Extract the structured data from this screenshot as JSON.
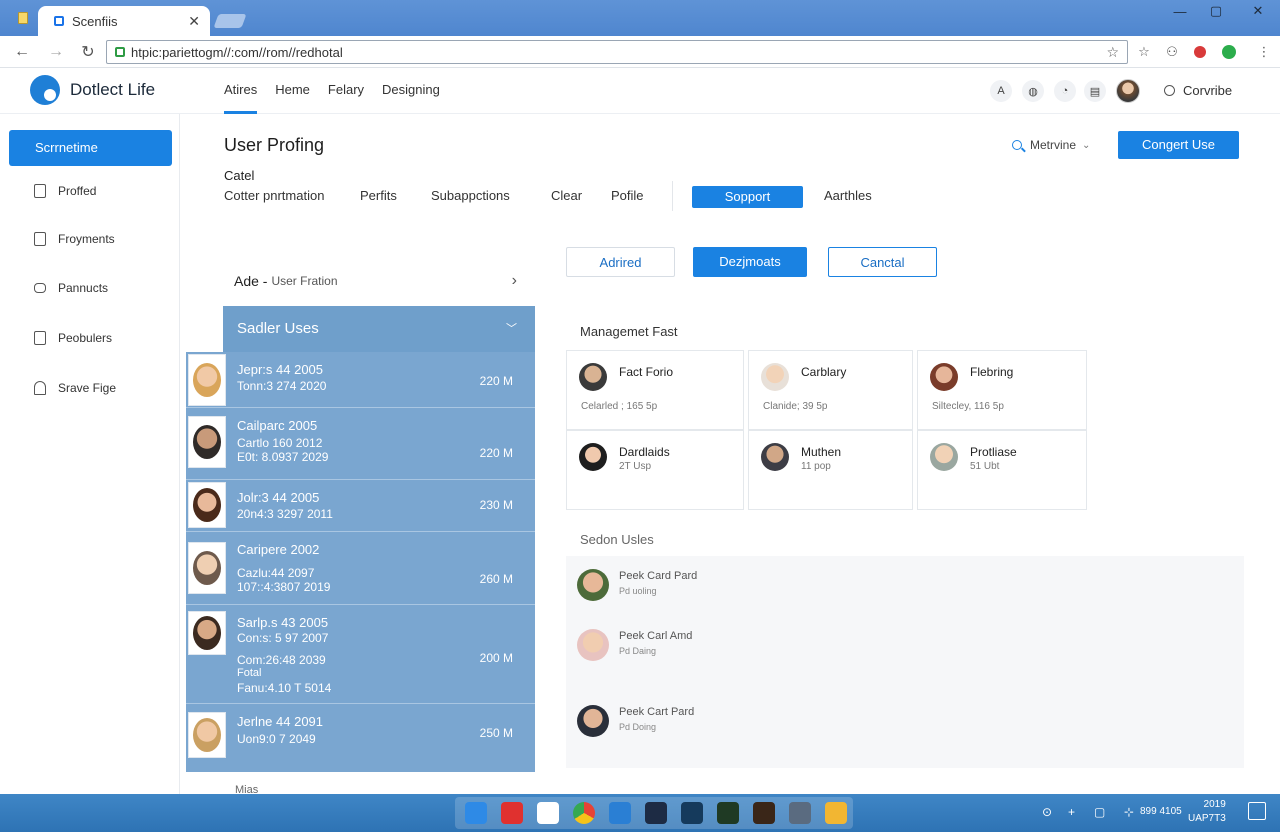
{
  "browser": {
    "tab_title": "Scenfiis",
    "tab_close": "✕",
    "url": "htpic:pariettogm//:com//rom//redhotal",
    "star_icon": "☆"
  },
  "app": {
    "brand": "Dotlect Life",
    "nav": [
      "Atires",
      "Heme",
      "Felary",
      "Designing"
    ],
    "header_link": "Corvribe"
  },
  "sidebar": {
    "cta": "Scrrnetime",
    "items": [
      "Proffed",
      "Froyments",
      "Pannucts",
      "Peobulers",
      "Srave Fige"
    ]
  },
  "main": {
    "title": "User Profing",
    "subhead": "Catel",
    "tabs": [
      "Cotter pnrtmation",
      "Perfits",
      "Subappctions",
      "Clear",
      "Pofile"
    ],
    "support_tab": "Sopport",
    "aux_tab": "Aarthles",
    "search_link": "Metrvine",
    "primary_button": "Congert Use"
  },
  "list": {
    "header": "Ade -",
    "header_sub": "User Fration",
    "group": "Sadler Uses",
    "rows": [
      {
        "lines": [
          "Jepr:s 44 2005",
          "Tonn:3 274 2020"
        ],
        "size": "220 M"
      },
      {
        "lines": [
          "Cailparc 2005",
          "Cartlo 160 2012",
          "E0t: 8.0937 2029"
        ],
        "size": "220 M"
      },
      {
        "lines": [
          "Jolr:3 44 2005",
          "20n4:3 3297 2011"
        ],
        "size": "230 M"
      },
      {
        "lines": [
          "Caripere 2002",
          "Cazlu:44 2097",
          "107::4:3807 2019"
        ],
        "size": "260 M"
      },
      {
        "lines": [
          "Sarlp.s 43 2005",
          "Con:s: 5 97 2007",
          "Com:26:48 2039",
          "Fotal",
          "Fanu:4.10 T 5014"
        ],
        "size": "200 M"
      },
      {
        "lines": [
          "Jerlne 44 2091",
          "Uon9:0 7 2049"
        ],
        "size": "250 M"
      }
    ],
    "tail": "Mias"
  },
  "actions": {
    "a1": "Adrired",
    "a2": "Dezjmoats",
    "a3": "Canctal"
  },
  "management": {
    "label": "Managemet Fast",
    "cards": [
      {
        "name": "Fact Forio",
        "meta": "Celarled ; 165 5p"
      },
      {
        "name": "Carblary",
        "meta": "Clanide; 39 5p"
      },
      {
        "name": "Flebring",
        "meta": "Siltecley, 116 5p"
      },
      {
        "name": "Dardlaids",
        "meta": "2T Usp"
      },
      {
        "name": "Muthen",
        "meta": "11 pop"
      },
      {
        "name": "Protliase",
        "meta": "51 Ubt"
      }
    ]
  },
  "recent": {
    "label": "Sedon Usles",
    "items": [
      {
        "name": "Peek Card Pard",
        "sub": "Pd uoling"
      },
      {
        "name": "Peek Carl Amd",
        "sub": "Pd Daing"
      },
      {
        "name": "Peek Cart Pard",
        "sub": "Pd Doing"
      }
    ]
  },
  "taskbar": {
    "tray_items": [
      "⊙",
      "+",
      "▢",
      "⊹"
    ],
    "tray_text": "899 4105",
    "time": "2019",
    "date": "UAP7T3"
  },
  "colors": {
    "accent": "#1a82e2",
    "list_bg": "#7aa6d0",
    "group_bg": "#6f9fcb",
    "taskbar": "#2e73b4"
  }
}
